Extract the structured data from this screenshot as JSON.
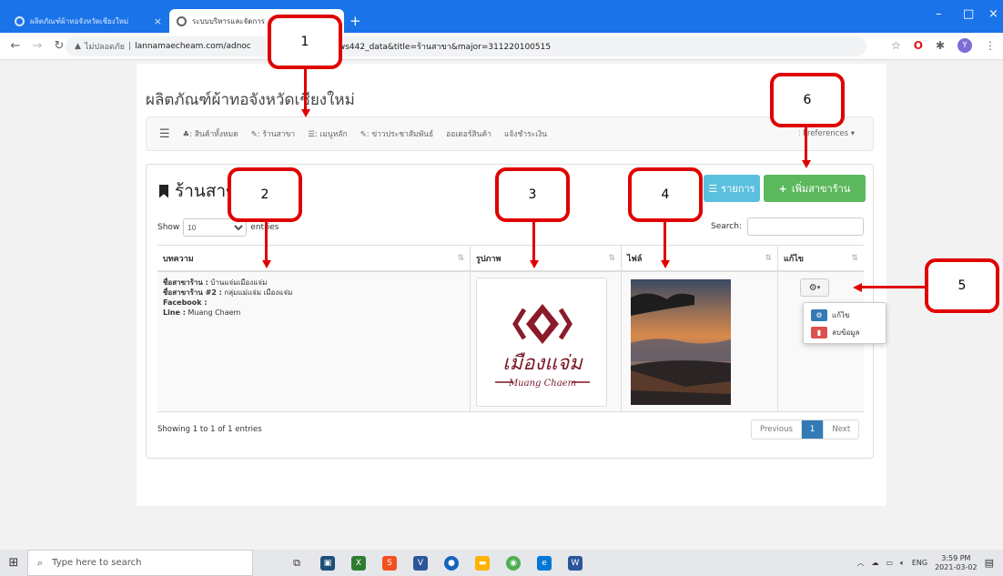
{
  "browser": {
    "tab1_title": "ผลิตภัณฑ์ผ้าทอจังหวัดเชียงใหม่",
    "tab2_title": "ระบบบริหารและจัดการ #",
    "new_tab": "+",
    "security_label": "ไม่ปลอดภัย",
    "url_host": "lannamaecheam.com/adnoc",
    "url_rest": "ws442_data&title=ร้านสาขา&major=311220100515",
    "extension_avatar": "Y"
  },
  "site": {
    "brand": "ผลิตภัณฑ์ผ้าทอจังหวัดเชียงใหม่",
    "nav": [
      {
        "icon": "home-icon",
        "label": ": สินค้าทั้งหมด"
      },
      {
        "icon": "leaf-icon",
        "label": ": ร้านสาขา"
      },
      {
        "icon": "list-icon",
        "label": ": เมนูหลัก"
      },
      {
        "icon": "leaf-icon",
        "label": ": ข่าวประชาสัมพันธ์"
      },
      {
        "icon": "",
        "label": "ออเดอร์สินค้า"
      },
      {
        "icon": "",
        "label": "แจ้งชำระเงิน"
      }
    ],
    "preferences": "Preferences ▾"
  },
  "panel": {
    "title": "ร้านสาขา",
    "list_button": "รายการ",
    "add_button": "เพิ่มสาขาร้าน",
    "show_label": "Show",
    "entries_value": "10",
    "entries_label": "entries",
    "search_label": "Search:"
  },
  "table": {
    "headers": [
      "บทความ",
      "รูปภาพ",
      "ไฟล์",
      "แก้ไข"
    ],
    "row": {
      "branch_name_label": "ชื่อสาขาร้าน :",
      "branch_name": "บ้านแจ่มเมืองแจ่ม",
      "branch2_label": "ชื่อสาขาร้าน #2 :",
      "branch2": "กลุ่มแม่แจ่ม เมืองแจ่ม",
      "facebook_label": "Facebook :",
      "facebook": "",
      "line_label": "Line :",
      "line": "Muang Chaem",
      "logo_thai": "เมืองแจ่ม",
      "logo_latin": "Muang Chaem"
    },
    "actions": {
      "edit": "แก้ไข",
      "delete": "ลบข้อมูล"
    }
  },
  "footer": {
    "info": "Showing 1 to 1 of 1 entries",
    "prev": "Previous",
    "page": "1",
    "next": "Next"
  },
  "callouts": [
    "1",
    "2",
    "3",
    "4",
    "5",
    "6"
  ],
  "taskbar": {
    "search_placeholder": "Type here to search",
    "lang": "ENG",
    "time": "3:59 PM",
    "date": "2021-03-02"
  },
  "colors": {
    "chrome_blue": "#1a73e8",
    "info": "#5bc0de",
    "success": "#5cb85c",
    "primary": "#337ab7",
    "danger": "#d9534f",
    "callout_red": "#e00000"
  }
}
